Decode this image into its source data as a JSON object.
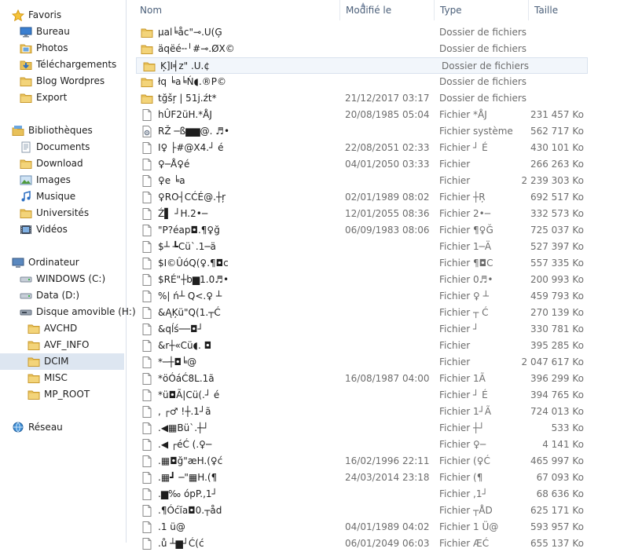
{
  "nav": {
    "favorites": {
      "label": "Favoris",
      "items": [
        {
          "label": "Bureau",
          "icon": "desktop-icon"
        },
        {
          "label": "Photos",
          "icon": "photos-icon"
        },
        {
          "label": "Téléchargements",
          "icon": "downloads-icon"
        },
        {
          "label": "Blog Wordpres",
          "icon": "folder-icon"
        },
        {
          "label": "Export",
          "icon": "folder-icon"
        }
      ]
    },
    "libraries": {
      "label": "Bibliothèques",
      "items": [
        {
          "label": "Documents",
          "icon": "documents-icon"
        },
        {
          "label": "Download",
          "icon": "folder-icon"
        },
        {
          "label": "Images",
          "icon": "images-icon"
        },
        {
          "label": "Musique",
          "icon": "music-icon"
        },
        {
          "label": "Universités",
          "icon": "folder-icon"
        },
        {
          "label": "Vidéos",
          "icon": "videos-icon"
        }
      ]
    },
    "computer": {
      "label": "Ordinateur",
      "items": [
        {
          "label": "WINDOWS (C:)",
          "icon": "drive-icon"
        },
        {
          "label": "Data (D:)",
          "icon": "drive-icon"
        },
        {
          "label": "Disque amovible (H:)",
          "icon": "removable-drive-icon"
        },
        {
          "label": "AVCHD",
          "icon": "folder-icon"
        },
        {
          "label": "AVF_INFO",
          "icon": "folder-icon"
        },
        {
          "label": "DCIM",
          "icon": "folder-icon",
          "selected": true
        },
        {
          "label": "MISC",
          "icon": "folder-icon"
        },
        {
          "label": "MP_ROOT",
          "icon": "folder-icon"
        }
      ]
    },
    "network": {
      "label": "Réseau"
    }
  },
  "columns": {
    "name": "Nom",
    "modified": "Modifié le",
    "type": "Type",
    "size": "Taille"
  },
  "files": [
    {
      "name": "µal╘åc\"⊸.U(Ģ",
      "date": "",
      "type": "Dossier de fichiers",
      "size": "",
      "kind": "folder"
    },
    {
      "name": "äqëé╌╵#⊸.ØX©",
      "date": "",
      "type": "Dossier de fichiers",
      "size": "",
      "kind": "folder"
    },
    {
      "name": "Ķ]Ι╡z\"   .U.¢",
      "date": "",
      "type": "Dossier de fichiers",
      "size": "",
      "kind": "folder",
      "hover": true
    },
    {
      "name": "łq ╘a╘Ń◖.®P©",
      "date": "",
      "type": "Dossier de fichiers",
      "size": "",
      "kind": "folder"
    },
    {
      "name": "tğšŗ  |  51j.źt*",
      "date": "21/12/2017 03:17",
      "type": "Dossier de fichiers",
      "size": "",
      "kind": "folder"
    },
    {
      "name": "hÛF2üH.*ÅJ",
      "date": "20/08/1985 05:04",
      "type": "Fichier *ÅJ",
      "size": "231 457 Ko",
      "kind": "file"
    },
    {
      "name": "RŽ  ─ß▆▆@. ♬•",
      "date": "",
      "type": "Fichier système",
      "size": "562 717 Ko",
      "kind": "system"
    },
    {
      "name": "Ι♀ ├#@X4.┘  é",
      "date": "22/08/2051 02:33",
      "type": "Fichier ┘  É",
      "size": "430 101 Ko",
      "kind": "file"
    },
    {
      "name": "♀─Å♀é",
      "date": "04/01/2050 03:33",
      "type": "Fichier",
      "size": "266 263 Ko",
      "kind": "file"
    },
    {
      "name": "♀e ╘a",
      "date": "",
      "type": "Fichier",
      "size": "2 239 303 Ko",
      "kind": "file"
    },
    {
      "name": "♀RO┤CĆÉ@.┼ŗ",
      "date": "02/01/1989 08:02",
      "type": "Fichier ┼Ŗ",
      "size": "692 517 Ko",
      "kind": "file"
    },
    {
      "name": "Ź▌   ┘H.2•─",
      "date": "12/01/2055 08:36",
      "type": "Fichier 2•─",
      "size": "332 573 Ko",
      "kind": "file"
    },
    {
      "name": "\"P?éap◘.¶♀ğ",
      "date": "06/09/1983 08:06",
      "type": "Fichier ¶♀Ğ",
      "size": "725 037 Ko",
      "kind": "file"
    },
    {
      "name": "$┴ ┺Cü`.1─ä",
      "date": "",
      "type": "Fichier 1─Ä",
      "size": "527 397 Ko",
      "kind": "file"
    },
    {
      "name": "$Ι©ÛóQ(♀.¶◘c",
      "date": "",
      "type": "Fichier ¶◘C",
      "size": "557 335 Ko",
      "kind": "file"
    },
    {
      "name": "$RÉ\"┼b▆1.0♬•",
      "date": "",
      "type": "Fichier 0♬•",
      "size": "200 993 Ko",
      "kind": "file"
    },
    {
      "name": "%| ń┴    Q<.♀   ┴",
      "date": "",
      "type": "Fichier ♀   ┴",
      "size": "459 793 Ko",
      "kind": "file"
    },
    {
      "name": "&ĄĶü\"Q(1.┬Ć",
      "date": "",
      "type": "Fichier ┬ Ć",
      "size": "270 139 Ko",
      "kind": "file"
    },
    {
      "name": "&qĺś──◘┘",
      "date": "",
      "type": "Fichier ┘",
      "size": "330 781 Ko",
      "kind": "file"
    },
    {
      "name": "&r┼«Cü◖. ◘",
      "date": "",
      "type": "Fichier",
      "size": "395 285 Ko",
      "kind": "file"
    },
    {
      "name": "*─┼◘╘@",
      "date": "",
      "type": "Fichier",
      "size": "2 047 617 Ko",
      "kind": "file"
    },
    {
      "name": "*öÓáĆ8L.1ã",
      "date": "16/08/1987 04:00",
      "type": "Fichier 1Ã",
      "size": "396 299 Ko",
      "kind": "file"
    },
    {
      "name": "*ü◘Ã|Cü(.┘  é",
      "date": "",
      "type": "Fichier ┘  É",
      "size": "394 765 Ko",
      "kind": "file"
    },
    {
      "name": ",     ┌♂  !┼.1┘ã",
      "date": "",
      "type": "Fichier 1┘Ã",
      "size": "724 013 Ko",
      "kind": "file"
    },
    {
      "name": ".◀▦Bü`.┼┘",
      "date": "",
      "type": "Fichier ┼┘",
      "size": "533 Ko",
      "kind": "file"
    },
    {
      "name": ".◀ ┌éĆ  (.♀─",
      "date": "",
      "type": "Fichier ♀─",
      "size": "4 141 Ko",
      "kind": "file"
    },
    {
      "name": ".▦◘ğ\"æH.(♀ć",
      "date": "16/02/1996 22:11",
      "type": "Fichier (♀Ć",
      "size": "465 997 Ko",
      "kind": "file"
    },
    {
      "name": ".▦┛ ─\"▦H.(¶",
      "date": "24/03/2014 23:18",
      "type": "Fichier (¶",
      "size": "67 093 Ko",
      "kind": "file"
    },
    {
      "name": ".▆‰  ópP.,1┘",
      "date": "",
      "type": "Fichier ,1┘",
      "size": "68 636 Ko",
      "kind": "file"
    },
    {
      "name": ".¶Óćĭa◘0.┬åd",
      "date": "",
      "type": "Fichier ┬ÅD",
      "size": "625 171 Ko",
      "kind": "file"
    },
    {
      "name": ".1 ü@",
      "date": "04/01/1989 04:02",
      "type": "Fichier 1 Ü@",
      "size": "593 957 Ko",
      "kind": "file"
    },
    {
      "name": ".ů  ┴▆┘Ć(ć",
      "date": "06/01/2049 06:03",
      "type": "Fichier ÆĆ",
      "size": "655 137 Ko",
      "kind": "file"
    }
  ],
  "colors": {
    "folder": "#e8c15a",
    "folder_dark": "#c99a2e",
    "selected": "#dde6f1",
    "header_text": "#4c607a"
  }
}
